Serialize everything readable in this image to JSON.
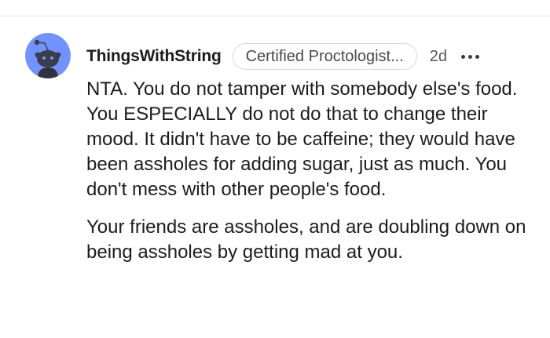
{
  "comment": {
    "author": "ThingsWithString",
    "flair": "Certified Proctologist...",
    "timestamp": "2d",
    "more_icon": "more-horizontal-icon",
    "avatar_icon": "snoo-avatar-icon",
    "paragraphs": [
      "NTA. You do not tamper with somebody else's food. You ESPECIALLY do not do that to change their mood. It didn't have to be caffeine; they would have been assholes for adding sugar, just as much. You don't mess with other people's food.",
      "Your friends are assholes, and are doubling down on being assholes by getting mad at you."
    ]
  },
  "colors": {
    "avatar_bg": "#7193ff",
    "text": "#1c1c1c",
    "muted": "#555555",
    "divider": "#e5e5e5",
    "flair_border": "#d7d7d7"
  }
}
